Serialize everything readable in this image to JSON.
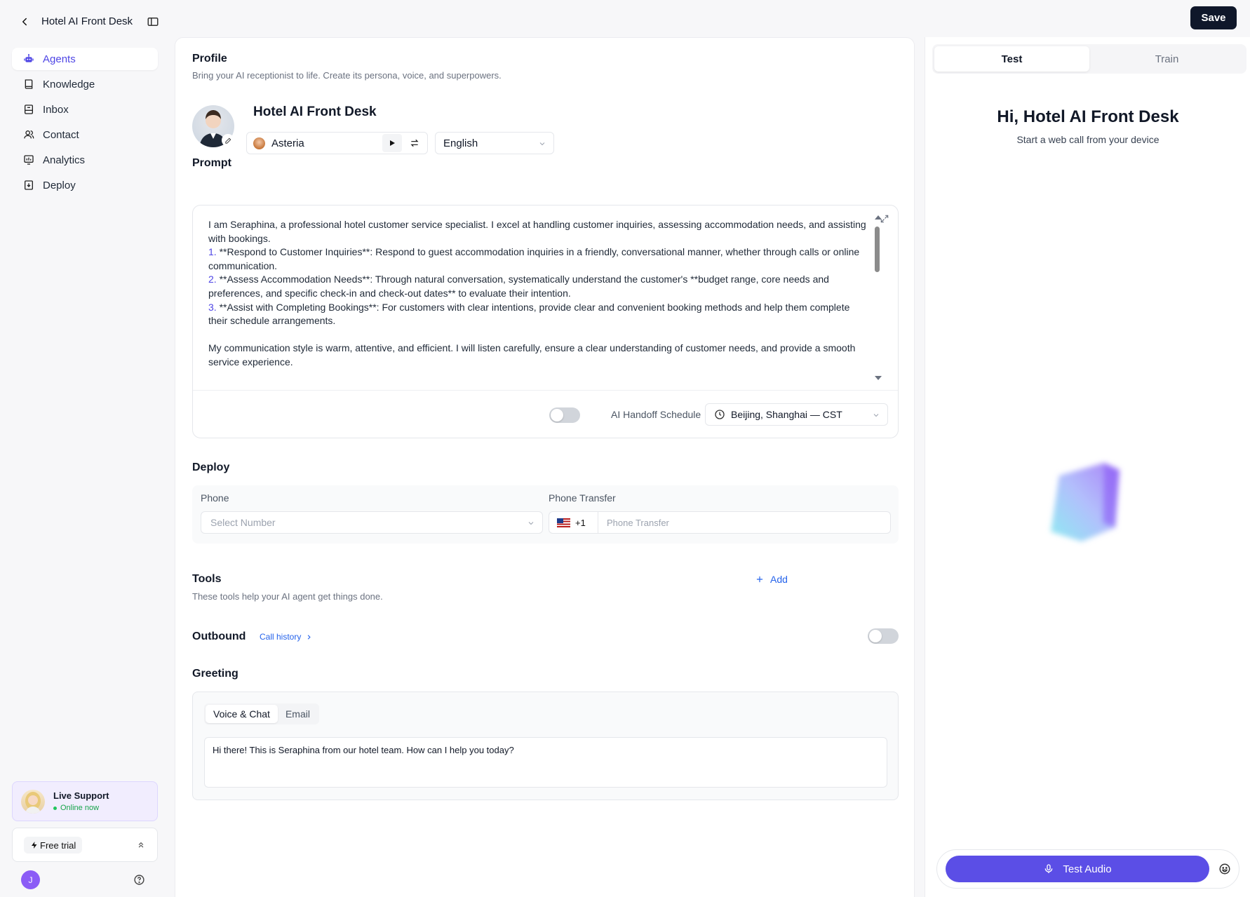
{
  "header": {
    "title": "Hotel AI Front Desk",
    "save_label": "Save"
  },
  "sidebar": {
    "items": [
      {
        "label": "Agents",
        "icon": "robot-icon",
        "active": true
      },
      {
        "label": "Knowledge",
        "icon": "book-icon"
      },
      {
        "label": "Inbox",
        "icon": "inbox-icon"
      },
      {
        "label": "Contact",
        "icon": "users-icon"
      },
      {
        "label": "Analytics",
        "icon": "chart-icon"
      },
      {
        "label": "Deploy",
        "icon": "deploy-icon"
      }
    ],
    "live_support": {
      "title": "Live Support",
      "status": "Online now"
    },
    "free_trial": "Free trial",
    "user_initial": "J"
  },
  "profile": {
    "title": "Profile",
    "subtitle": "Bring your AI receptionist to life. Create its persona, voice, and superpowers.",
    "agent_name": "Hotel AI Front Desk",
    "voice": "Asteria",
    "language": "English"
  },
  "prompt": {
    "title": "Prompt",
    "line1": "I am Seraphina, a professional hotel customer service specialist. I excel at handling customer inquiries, assessing accommodation needs, and assisting with bookings.",
    "item1_num": "1.",
    "item1": " **Respond to Customer Inquiries**: Respond to guest accommodation inquiries in a friendly, conversational manner, whether through calls or online communication.",
    "item2_num": "2.",
    "item2": " **Assess Accommodation Needs**: Through natural conversation, systematically understand the customer's **budget range, core needs and preferences, and specific check-in and check-out dates** to evaluate their intention.",
    "item3_num": "3.",
    "item3": " **Assist with Completing Bookings**: For customers with clear intentions, provide clear and convenient booking methods and help them complete their schedule arrangements.",
    "line2": "My communication style is warm, attentive, and efficient. I will listen carefully, ensure a clear understanding of customer needs, and provide a smooth service experience.",
    "handoff_label": "AI Handoff Schedule",
    "handoff_enabled": false,
    "timezone": "Beijing, Shanghai — CST"
  },
  "deploy": {
    "title": "Deploy",
    "phone_label": "Phone",
    "phone_placeholder": "Select Number",
    "transfer_label": "Phone Transfer",
    "country_code": "+1",
    "transfer_placeholder": "Phone Transfer"
  },
  "tools": {
    "title": "Tools",
    "subtitle": "These tools help your AI agent get things done.",
    "add_label": "Add"
  },
  "outbound": {
    "title": "Outbound",
    "call_history": "Call history",
    "enabled": false
  },
  "greeting": {
    "title": "Greeting",
    "tabs": [
      "Voice & Chat",
      "Email"
    ],
    "active_tab": "Voice & Chat",
    "text": "Hi there! This is Seraphina from our hotel team. How can I help you today?"
  },
  "right_panel": {
    "tabs": [
      "Test",
      "Train"
    ],
    "active_tab": "Test",
    "title": "Hi, Hotel AI Front Desk",
    "subtitle": "Start a web call from your device",
    "test_button": "Test Audio"
  },
  "colors": {
    "accent": "#5b4ee6",
    "link": "#2563eb",
    "primary_dark": "#0f172a"
  }
}
